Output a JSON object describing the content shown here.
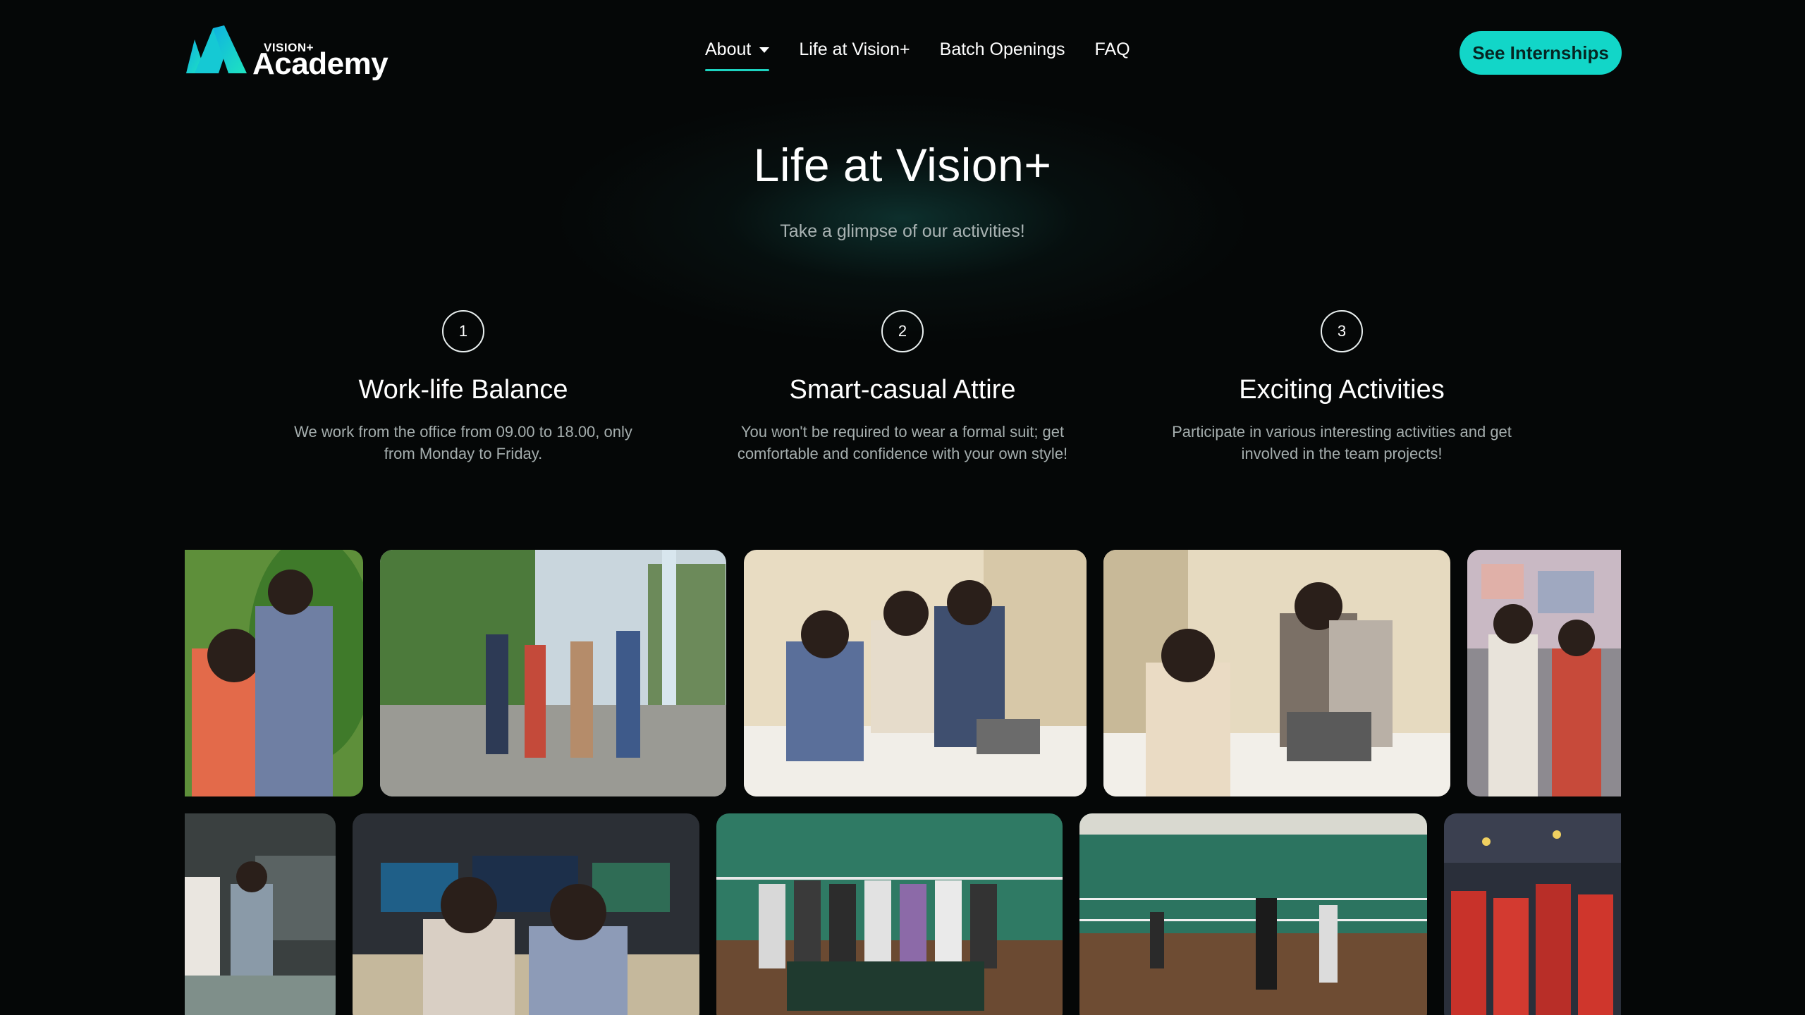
{
  "logo": {
    "top_text": "VISION+",
    "main_text": "Academy",
    "colors": {
      "mark_left": "#10b8d8",
      "mark_right": "#1ee0c0"
    }
  },
  "nav": {
    "items": [
      {
        "label": "About",
        "has_dropdown": true,
        "active": true
      },
      {
        "label": "Life at Vision+",
        "has_dropdown": false,
        "active": false
      },
      {
        "label": "Batch Openings",
        "has_dropdown": false,
        "active": false
      },
      {
        "label": "FAQ",
        "has_dropdown": false,
        "active": false
      }
    ]
  },
  "cta": {
    "label": "See Internships",
    "color": "#12d6c8"
  },
  "hero": {
    "title": "Life at Vision+",
    "subtitle": "Take a glimpse of our activities!"
  },
  "features": [
    {
      "number": "1",
      "title": "Work-life Balance",
      "desc_line1": "We work from the office from 09.00 to 18.00, only",
      "desc_line2": "from Monday to Friday."
    },
    {
      "number": "2",
      "title": "Smart-casual Attire",
      "desc_line1": "You won't be required to wear a formal suit; get",
      "desc_line2": "comfortable and confidence with your own style!"
    },
    {
      "number": "3",
      "title": "Exciting Activities",
      "desc_line1": "Participate in various interesting activities and get",
      "desc_line2": "involved in the team projects!"
    }
  ],
  "gallery": {
    "row1": [
      {
        "scene": "outdoor-greenery"
      },
      {
        "scene": "outdoor-walk"
      },
      {
        "scene": "office-meeting"
      },
      {
        "scene": "office-laptop"
      },
      {
        "scene": "lobby-screens"
      }
    ],
    "row2": [
      {
        "scene": "innovation-center"
      },
      {
        "scene": "control-room"
      },
      {
        "scene": "badminton-group"
      },
      {
        "scene": "badminton-play"
      },
      {
        "scene": "event-hall"
      }
    ]
  }
}
